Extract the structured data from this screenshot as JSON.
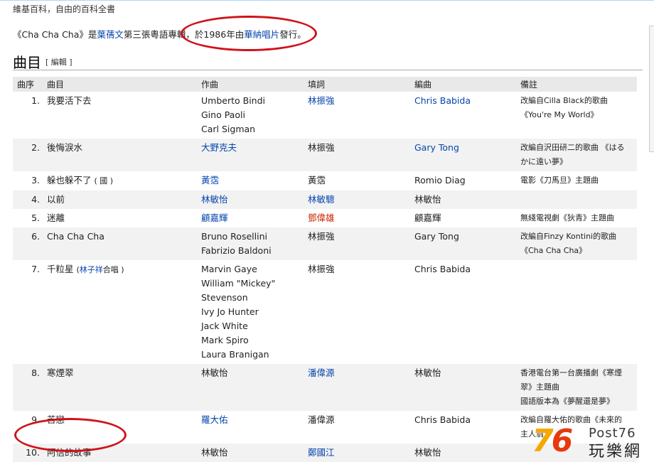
{
  "page": {
    "tagline": "維基百科，自由的百科全書",
    "intro": {
      "before": "《Cha Cha Cha》是",
      "artist_link": "葉蒨文",
      "middle": "第三張粵語專輯，於1986年由",
      "label_link": "華納唱片",
      "after": "發行。"
    },
    "section_title": "曲目",
    "edit_label": "[ 編輯 ]"
  },
  "table": {
    "headers": [
      "曲序",
      "曲目",
      "作曲",
      "填詞",
      "編曲",
      "備註"
    ],
    "rows": [
      {
        "no": "1.",
        "title": "我要活下去",
        "composers": [
          "Umberto Bindi",
          "Gino Paoli",
          "Carl Sigman"
        ],
        "lyricist": "林振強",
        "arranger": "Chris Babida",
        "notes": [
          "改編自Cilla Black的歌曲",
          "《You're My World》"
        ]
      },
      {
        "no": "2.",
        "title": "後悔淚水",
        "composers": [
          "大野克夫"
        ],
        "lyricist": "林振強",
        "arranger": "Gary Tong",
        "notes": [
          "改編自沢田研二的歌曲 《はる",
          "かに遠い夢》"
        ]
      },
      {
        "no": "3.",
        "title": "躲也躲不了",
        "title_sub": "( 國 )",
        "composers": [
          "黃霑"
        ],
        "lyricist": "黃霑",
        "arranger": "Romio Diag",
        "notes": [
          "電影《刀馬旦》主題曲"
        ]
      },
      {
        "no": "4.",
        "title": "以前",
        "composers": [
          "林敏怡"
        ],
        "lyricist": "林敏驄",
        "arranger": "林敏怡",
        "notes": []
      },
      {
        "no": "5.",
        "title": "迷離",
        "composers": [
          "顧嘉輝"
        ],
        "lyricist": "鄧偉雄",
        "arranger": "顧嘉輝",
        "notes": [
          "無綫電視劇《狄青》主題曲"
        ]
      },
      {
        "no": "6.",
        "title": "Cha Cha Cha",
        "composers": [
          "Bruno Rosellini",
          "Fabrizio Baldoni"
        ],
        "lyricist": "林振強",
        "arranger": "Gary Tong",
        "notes": [
          "改編自Finzy Kontini的歌曲",
          "《Cha Cha Cha》"
        ]
      },
      {
        "no": "7.",
        "title": "千粒星",
        "title_sub_open": "(",
        "title_sub_link": "林子祥",
        "title_sub_close": "合唱 )",
        "composers": [
          "Marvin Gaye",
          "William \"Mickey\"",
          "Stevenson",
          "Ivy Jo Hunter",
          "Jack White",
          "Mark Spiro",
          "Laura Branigan"
        ],
        "lyricist": "林振強",
        "arranger": "Chris Babida",
        "notes": []
      },
      {
        "no": "8.",
        "title": "寒煙翠",
        "composers": [
          "林敏怡"
        ],
        "lyricist": "潘偉源",
        "arranger": "林敏怡",
        "notes": [
          "香港電台第一台廣播劇《寒煙",
          "翠》主題曲",
          "國語版本為《夢醒還是夢》"
        ]
      },
      {
        "no": "9.",
        "title": "苦戀",
        "composers": [
          "羅大佑"
        ],
        "lyricist": "潘偉源",
        "arranger": "Chris Babida",
        "notes": [
          "改編自羅大佑的歌曲《未來的",
          "主人翁》"
        ]
      },
      {
        "no": "10.",
        "title": "阿信的故事",
        "composers": [
          "林敏怡"
        ],
        "lyricist": "鄭國江",
        "arranger": "林敏怡",
        "notes": []
      }
    ]
  },
  "watermark": {
    "number": "76",
    "number_first": "7",
    "number_second": "6",
    "brand": "Post76",
    "brand_cn": "玩樂網"
  },
  "colors": {
    "link": "#0645ad",
    "annotation_red": "#d0121a",
    "header_bg": "#e9e9e9",
    "alt_row_bg": "#f2f2f2"
  }
}
